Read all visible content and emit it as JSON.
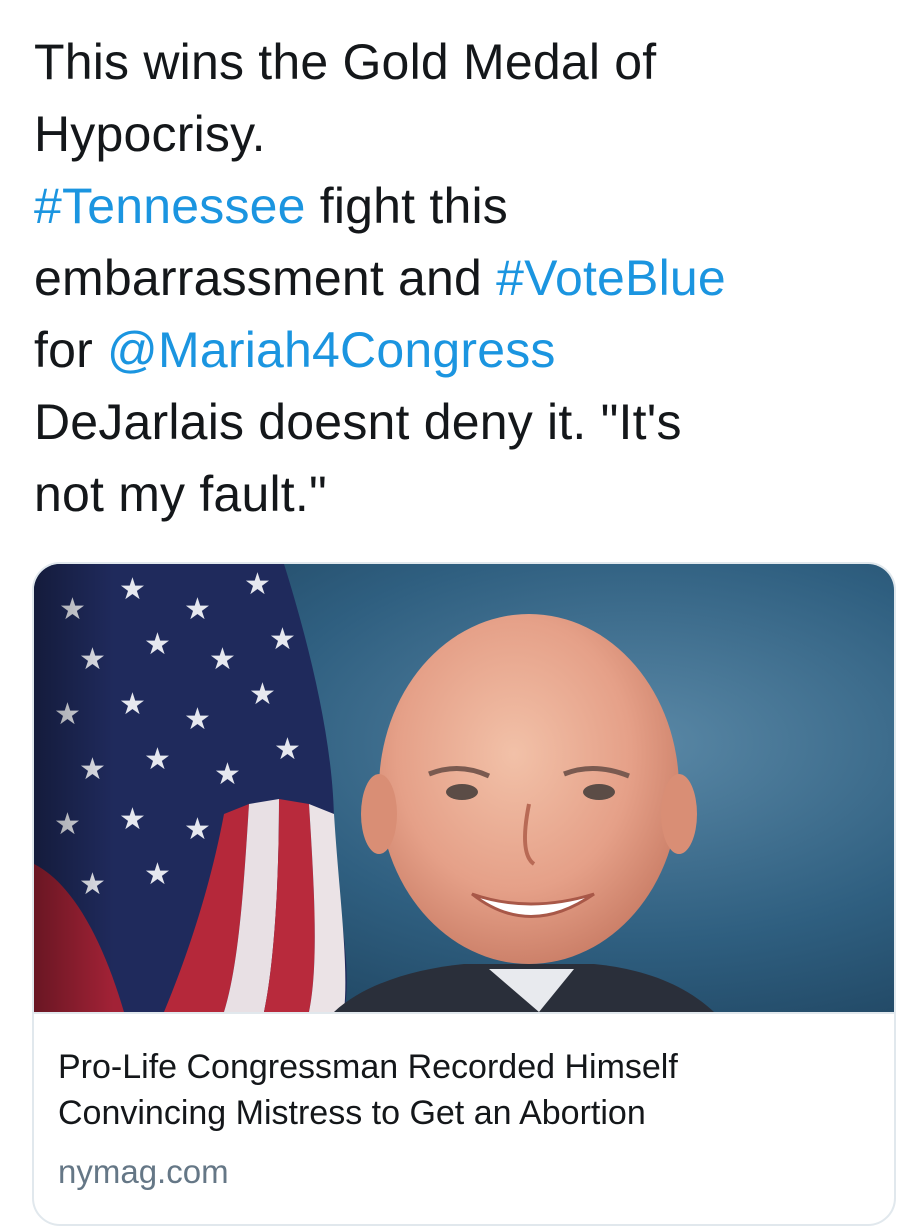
{
  "tweet": {
    "line1": "This wins the Gold Medal of",
    "line2": "Hypocrisy.",
    "hashtag_tennessee": "#Tennessee",
    "line3_rest": " fight this",
    "line4_start": "embarrassment and ",
    "hashtag_voteblue": "#VoteBlue",
    "line5_start": "for ",
    "mention": "@Mariah4Congress",
    "line6": "DeJarlais doesnt deny it. \"It's",
    "line7": "not my fault.\""
  },
  "card": {
    "title_line1": "Pro-Life Congressman Recorded Himself",
    "title_line2": "Convincing Mistress to Get an Abortion",
    "domain": "nymag.com"
  },
  "colors": {
    "link": "#1b95e0",
    "text": "#14171a",
    "secondary": "#657786",
    "border": "#e1e8ed"
  },
  "icons": {
    "image": "flag-and-portrait-photo"
  }
}
